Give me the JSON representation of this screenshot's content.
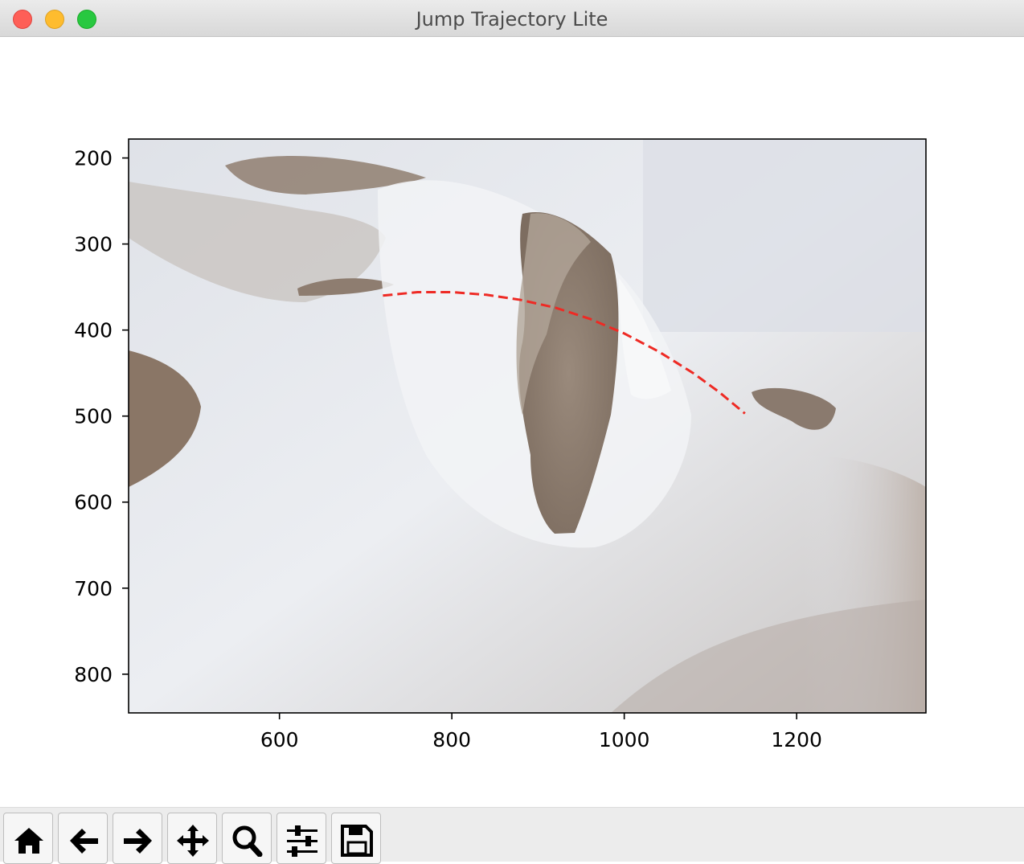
{
  "window": {
    "title": "Jump Trajectory Lite"
  },
  "toolbar": {
    "buttons": [
      {
        "name": "home",
        "icon": "home-icon"
      },
      {
        "name": "back",
        "icon": "arrow-left-icon"
      },
      {
        "name": "forward",
        "icon": "arrow-right-icon"
      },
      {
        "name": "pan",
        "icon": "move-icon"
      },
      {
        "name": "zoom",
        "icon": "magnifier-icon"
      },
      {
        "name": "configure-subplots",
        "icon": "sliders-icon"
      },
      {
        "name": "save",
        "icon": "floppy-disk-icon"
      }
    ]
  },
  "chart_data": {
    "type": "line",
    "background": "photo of snow terrain with a central hole",
    "xlim": [
      425,
      1350
    ],
    "ylim": [
      845,
      178
    ],
    "y_inverted": true,
    "xticks": [
      600,
      800,
      1000,
      1200
    ],
    "yticks": [
      200,
      300,
      400,
      500,
      600,
      700,
      800
    ],
    "series": [
      {
        "style": "dashed",
        "color": "#ee2a24",
        "x": [
          720,
          760,
          800,
          840,
          880,
          920,
          960,
          1000,
          1040,
          1080,
          1110,
          1140
        ],
        "y": [
          360,
          356,
          356,
          359,
          365,
          374,
          387,
          404,
          425,
          450,
          472,
          497
        ]
      }
    ]
  }
}
